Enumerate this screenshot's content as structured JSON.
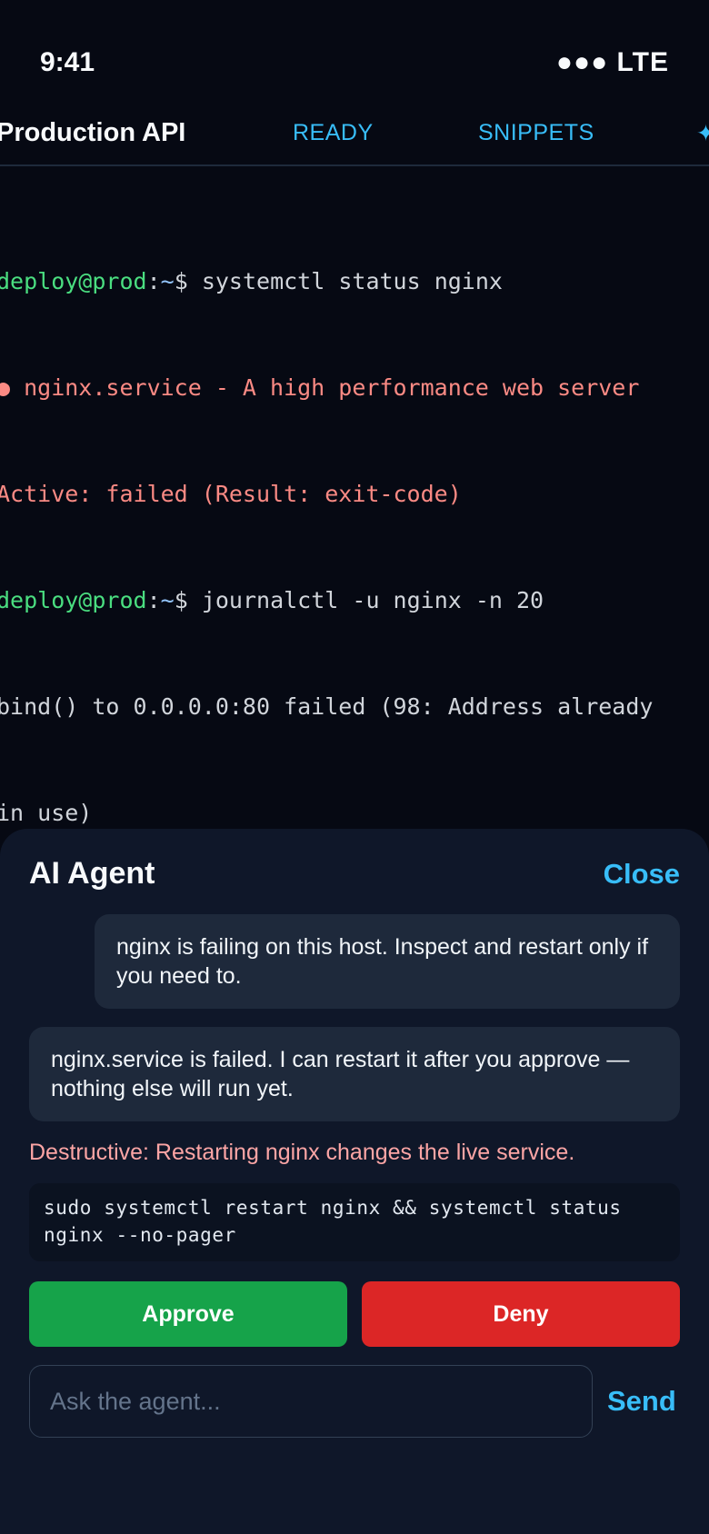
{
  "status_bar": {
    "time": "9:41",
    "signal": "●●● LTE"
  },
  "nav": {
    "title": "Production API",
    "tabs": [
      {
        "label": "READY"
      },
      {
        "label": "SNIPPETS"
      }
    ],
    "more_icon": "✦"
  },
  "terminal": {
    "prompt_user": "deploy@prod",
    "prompt_sep": ":",
    "prompt_path": "~",
    "prompt_symbol": "$",
    "commands": [
      "systemctl status nginx",
      "journalctl -u nginx -n 20"
    ],
    "output": [
      "● nginx.service - A high performance web server",
      "Active: failed (Result: exit-code)",
      "bind() to 0.0.0.0:80 failed (98: Address already",
      "in use)"
    ]
  },
  "agent_panel": {
    "title": "AI Agent",
    "close_label": "Close",
    "messages": [
      {
        "role": "user",
        "text": "nginx is failing on this host. Inspect and restart only if you need to."
      },
      {
        "role": "agent",
        "text": "nginx.service is failed. I can restart it after you approve — nothing else will run yet."
      }
    ],
    "warning": "Destructive: Restarting nginx changes the live service.",
    "command": "sudo systemctl restart nginx && systemctl status nginx --no-pager",
    "approve_label": "Approve",
    "deny_label": "Deny",
    "input_placeholder": "Ask the agent...",
    "send_label": "Send"
  },
  "colors": {
    "background": "#060913",
    "accent": "#38bdf8",
    "prompt_user": "#4ade80",
    "error_text": "#fb8a84",
    "approve": "#16a34a",
    "deny": "#dc2626"
  }
}
